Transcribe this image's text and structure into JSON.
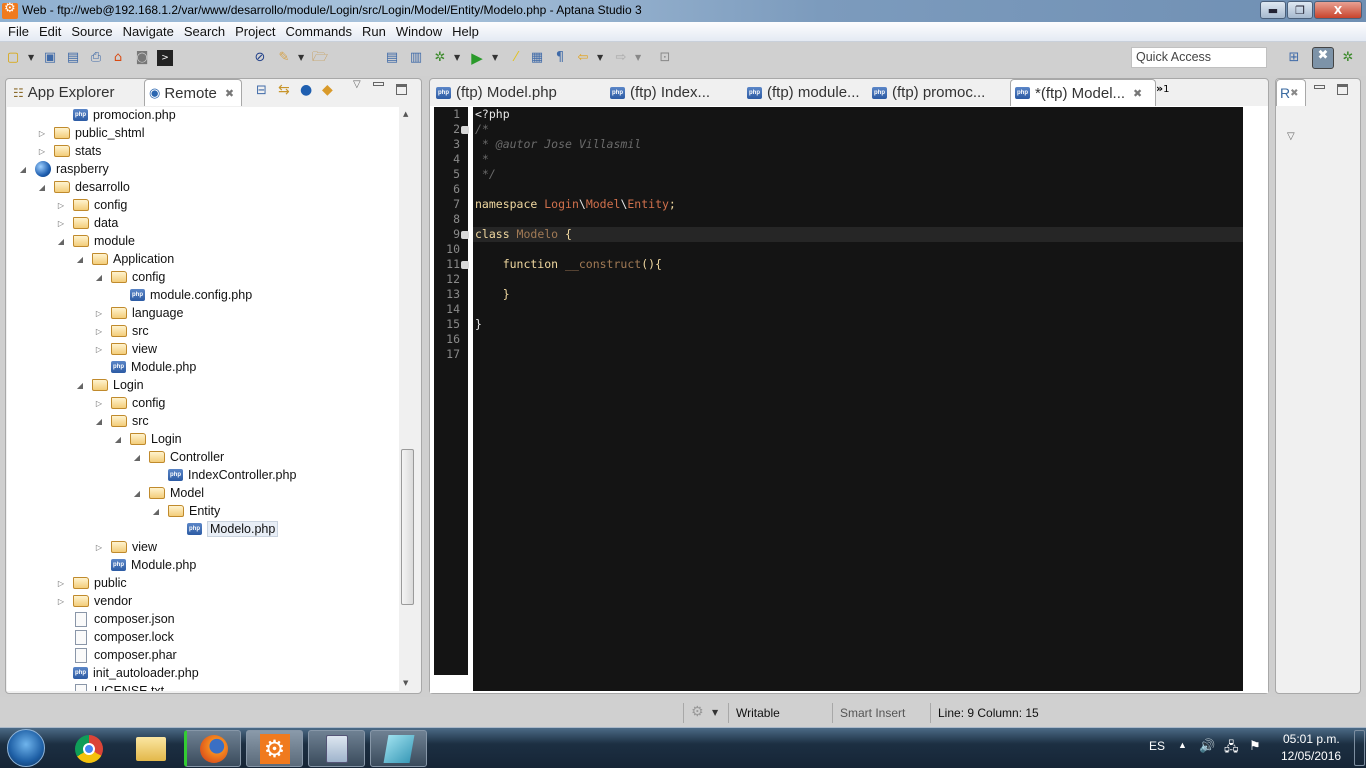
{
  "window": {
    "title": "Web - ftp://web@192.168.1.2/var/www/desarrollo/module/Login/src/Login/Model/Entity/Modelo.php - Aptana Studio 3",
    "buttons": {
      "minimize": "▬",
      "restore": "❐",
      "close": "X"
    }
  },
  "menu": [
    "File",
    "Edit",
    "Source",
    "Navigate",
    "Search",
    "Project",
    "Commands",
    "Run",
    "Window",
    "Help"
  ],
  "toolbar": {
    "icons": [
      "new-icon",
      "save-icon",
      "save-all-icon",
      "print-icon",
      "aptana-home-icon",
      "preview-icon",
      "terminal-icon",
      "toggle-mark-icon",
      "brush-icon",
      "open-project-icon",
      "open-type-icon",
      "open-resource-icon",
      "debug-icon",
      "run-icon",
      "highlight-icon",
      "block-select-icon",
      "show-whitespace-icon",
      "back-icon",
      "forward-icon",
      "pin-icon"
    ],
    "quick_access_placeholder": "Quick Access"
  },
  "left_panel": {
    "tabs": [
      {
        "label": "App Explorer",
        "icon": "app-explorer-icon"
      },
      {
        "label": "Remote",
        "icon": "remote-icon",
        "close": "✖"
      }
    ],
    "tree": [
      {
        "label": "promocion.php",
        "type": "php",
        "depth": 2,
        "expanded": null
      },
      {
        "label": "public_shtml",
        "type": "folder",
        "depth": 1,
        "expanded": false
      },
      {
        "label": "stats",
        "type": "folder",
        "depth": 1,
        "expanded": false
      },
      {
        "label": "raspberry",
        "type": "globe",
        "depth": 0,
        "expanded": true
      },
      {
        "label": "desarrollo",
        "type": "folder",
        "depth": 1,
        "expanded": true
      },
      {
        "label": "config",
        "type": "folder",
        "depth": 2,
        "expanded": false
      },
      {
        "label": "data",
        "type": "folder",
        "depth": 2,
        "expanded": false
      },
      {
        "label": "module",
        "type": "folder",
        "depth": 2,
        "expanded": true
      },
      {
        "label": "Application",
        "type": "folder",
        "depth": 3,
        "expanded": true
      },
      {
        "label": "config",
        "type": "folder",
        "depth": 4,
        "expanded": true
      },
      {
        "label": "module.config.php",
        "type": "php",
        "depth": 5,
        "expanded": null
      },
      {
        "label": "language",
        "type": "folder",
        "depth": 4,
        "expanded": false
      },
      {
        "label": "src",
        "type": "folder",
        "depth": 4,
        "expanded": false
      },
      {
        "label": "view",
        "type": "folder",
        "depth": 4,
        "expanded": false
      },
      {
        "label": "Module.php",
        "type": "php",
        "depth": 4,
        "expanded": null
      },
      {
        "label": "Login",
        "type": "folder",
        "depth": 3,
        "expanded": true
      },
      {
        "label": "config",
        "type": "folder",
        "depth": 4,
        "expanded": false
      },
      {
        "label": "src",
        "type": "folder",
        "depth": 4,
        "expanded": true
      },
      {
        "label": "Login",
        "type": "folder",
        "depth": 5,
        "expanded": true
      },
      {
        "label": "Controller",
        "type": "folder",
        "depth": 6,
        "expanded": true
      },
      {
        "label": "IndexController.php",
        "type": "php",
        "depth": 7,
        "expanded": null
      },
      {
        "label": "Model",
        "type": "folder",
        "depth": 6,
        "expanded": true
      },
      {
        "label": "Entity",
        "type": "folder",
        "depth": 7,
        "expanded": true
      },
      {
        "label": "Modelo.php",
        "type": "php",
        "depth": 8,
        "expanded": null,
        "selected": true
      },
      {
        "label": "view",
        "type": "folder",
        "depth": 4,
        "expanded": false
      },
      {
        "label": "Module.php",
        "type": "php",
        "depth": 4,
        "expanded": null
      },
      {
        "label": "public",
        "type": "folder",
        "depth": 2,
        "expanded": false
      },
      {
        "label": "vendor",
        "type": "folder",
        "depth": 2,
        "expanded": false
      },
      {
        "label": "composer.json",
        "type": "doc",
        "depth": 2,
        "expanded": null
      },
      {
        "label": "composer.lock",
        "type": "doc",
        "depth": 2,
        "expanded": null
      },
      {
        "label": "composer.phar",
        "type": "doc",
        "depth": 2,
        "expanded": null
      },
      {
        "label": "init_autoloader.php",
        "type": "php",
        "depth": 2,
        "expanded": null
      },
      {
        "label": "LICENSE.txt",
        "type": "doc",
        "depth": 2,
        "expanded": null
      }
    ]
  },
  "editor": {
    "tabs": [
      {
        "label": "(ftp) Model.php",
        "active": false
      },
      {
        "label": "(ftp) Index...",
        "active": false
      },
      {
        "label": "(ftp) module...",
        "active": false
      },
      {
        "label": "(ftp) promoc...",
        "active": false
      },
      {
        "label": "*(ftp) Model...",
        "active": true,
        "close": "✖"
      }
    ],
    "overflow_label": "»",
    "overflow_count": "1",
    "line_numbers": [
      "1",
      "2",
      "3",
      "4",
      "5",
      "6",
      "7",
      "8",
      "9",
      "10",
      "11",
      "12",
      "13",
      "14",
      "15",
      "16",
      "17"
    ],
    "folds": [
      2,
      9,
      11
    ],
    "lines": [
      [
        {
          "t": "<?php",
          "c": "c-white"
        }
      ],
      [
        {
          "t": "/*",
          "c": "c-com"
        }
      ],
      [
        {
          "t": " * @autor Jose Villasmil",
          "c": "c-com"
        }
      ],
      [
        {
          "t": " *",
          "c": "c-com"
        }
      ],
      [
        {
          "t": " */",
          "c": "c-com"
        }
      ],
      [],
      [
        {
          "t": "namespace ",
          "c": "c-kw"
        },
        {
          "t": "Login",
          "c": "c-ns"
        },
        {
          "t": "\\",
          "c": "c-white"
        },
        {
          "t": "Model",
          "c": "c-ns"
        },
        {
          "t": "\\",
          "c": "c-white"
        },
        {
          "t": "Entity",
          "c": "c-ns"
        },
        {
          "t": ";",
          "c": "c-kw"
        }
      ],
      [],
      [
        {
          "t": "class ",
          "c": "c-kw"
        },
        {
          "t": "Modelo ",
          "c": "c-cls"
        },
        {
          "t": "{",
          "c": "c-kw"
        }
      ],
      [],
      [
        {
          "t": "    function ",
          "c": "c-kw"
        },
        {
          "t": "__construct",
          "c": "c-fn"
        },
        {
          "t": "(){",
          "c": "c-kw"
        }
      ],
      [],
      [
        {
          "t": "    }",
          "c": "c-kw"
        }
      ],
      [],
      [
        {
          "t": "}",
          "c": "c-white"
        }
      ],
      [],
      []
    ]
  },
  "right_panel": {
    "tab_label": "R",
    "close": "✖"
  },
  "status": {
    "writable": "Writable",
    "insert_mode": "Smart Insert",
    "position": "Line: 9 Column: 15"
  },
  "taskbar": {
    "apps": [
      "chrome-icon",
      "explorer-icon",
      "firefox-icon",
      "aptana-icon",
      "calculator-icon",
      "notepad-icon"
    ],
    "language": "ES",
    "time": "05:01 p.m.",
    "date": "12/05/2016"
  }
}
